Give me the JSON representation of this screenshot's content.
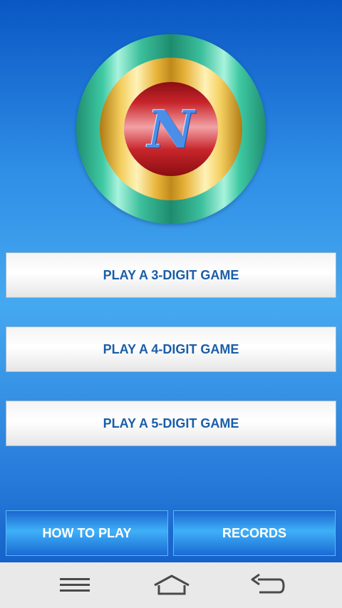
{
  "logo": {
    "letter": "N"
  },
  "games": [
    {
      "label": "PLAY A 3-DIGIT GAME"
    },
    {
      "label": "PLAY A 4-DIGIT GAME"
    },
    {
      "label": "PLAY A 5-DIGIT GAME"
    }
  ],
  "footer": {
    "how_to_play_label": "HOW TO PLAY",
    "records_label": "RECORDS"
  },
  "navbar": {
    "icons": [
      "menu-icon",
      "home-icon",
      "back-icon"
    ]
  },
  "colors": {
    "background": "#2f8ee6",
    "button_text": "#1a5ea8",
    "footer_button": "#3fb0f8",
    "navbar": "#e9e9e9"
  }
}
